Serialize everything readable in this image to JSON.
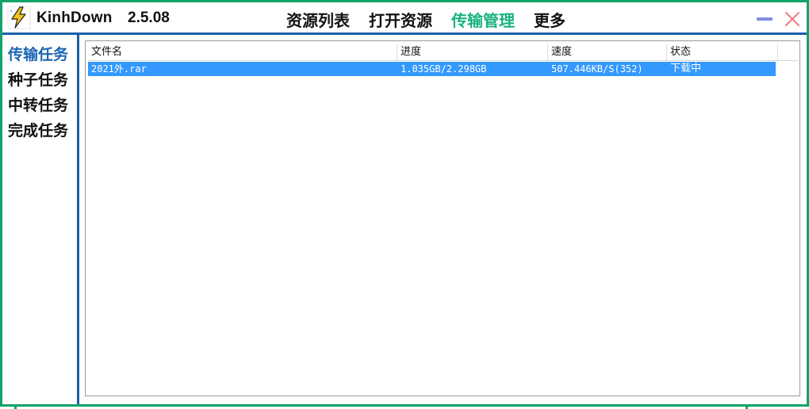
{
  "app": {
    "name": "KinhDown",
    "version": "2.5.08",
    "icon": "lightning-icon",
    "colors": {
      "frame": "#12a36a",
      "divider": "#1b5fa8",
      "nav_active": "#19b37c",
      "sidebar_active": "#1b64b4",
      "row_selected": "#3399ff"
    }
  },
  "nav": {
    "items": [
      {
        "label": "资源列表",
        "active": false
      },
      {
        "label": "打开资源",
        "active": false
      },
      {
        "label": "传输管理",
        "active": true
      },
      {
        "label": "更多",
        "active": false
      }
    ]
  },
  "window_controls": {
    "minimize_icon": "minimize-icon",
    "close_icon": "close-icon"
  },
  "sidebar": {
    "items": [
      {
        "label": "传输任务",
        "active": true
      },
      {
        "label": "种子任务",
        "active": false
      },
      {
        "label": "中转任务",
        "active": false
      },
      {
        "label": "完成任务",
        "active": false
      }
    ]
  },
  "table": {
    "columns": [
      "文件名",
      "进度",
      "速度",
      "状态"
    ],
    "rows": [
      {
        "filename": "2021外.rar",
        "progress": "1.035GB/2.298GB",
        "speed": "507.446KB/S(352)",
        "status": "下载中",
        "selected": true
      }
    ]
  }
}
